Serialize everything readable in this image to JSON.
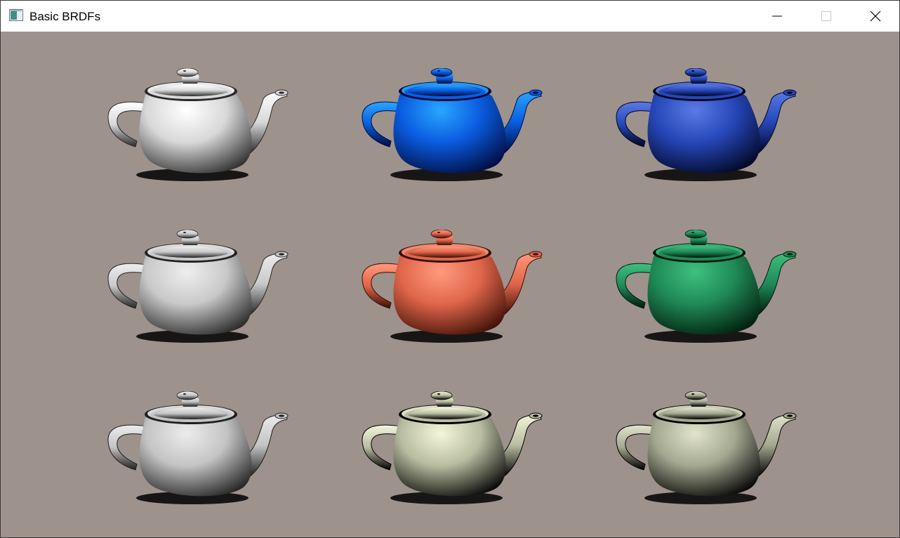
{
  "window": {
    "title": "Basic BRDFs",
    "app_icon": "application-window-icon",
    "controls": {
      "minimize_icon": "minimize-icon",
      "maximize_icon": "maximize-icon",
      "close_icon": "close-icon"
    }
  },
  "viewport": {
    "background_color": "#9e928d",
    "teapots": [
      {
        "row": 1,
        "col": 1,
        "color": "#d8d8d8",
        "highlight": "#ffffff",
        "shade": "#2a2a2a"
      },
      {
        "row": 1,
        "col": 2,
        "color": "#0a5ce0",
        "highlight": "#2aa6ff",
        "shade": "#000a3a"
      },
      {
        "row": 1,
        "col": 3,
        "color": "#2647b8",
        "highlight": "#5a7ae6",
        "shade": "#000520"
      },
      {
        "row": 2,
        "col": 1,
        "color": "#c9c9c9",
        "highlight": "#eeeeee",
        "shade": "#242424"
      },
      {
        "row": 2,
        "col": 2,
        "color": "#e0664a",
        "highlight": "#ff9a7e",
        "shade": "#3a0e06"
      },
      {
        "row": 2,
        "col": 3,
        "color": "#1f8a57",
        "highlight": "#3fc080",
        "shade": "#001a0a"
      },
      {
        "row": 3,
        "col": 1,
        "color": "#c4c4c4",
        "highlight": "#ececec",
        "shade": "#1e1e1e"
      },
      {
        "row": 3,
        "col": 2,
        "color": "#b8bca0",
        "highlight": "#f4f6dc",
        "shade": "#000000"
      },
      {
        "row": 3,
        "col": 3,
        "color": "#a4a890",
        "highlight": "#e2e4cc",
        "shade": "#000000"
      }
    ]
  }
}
